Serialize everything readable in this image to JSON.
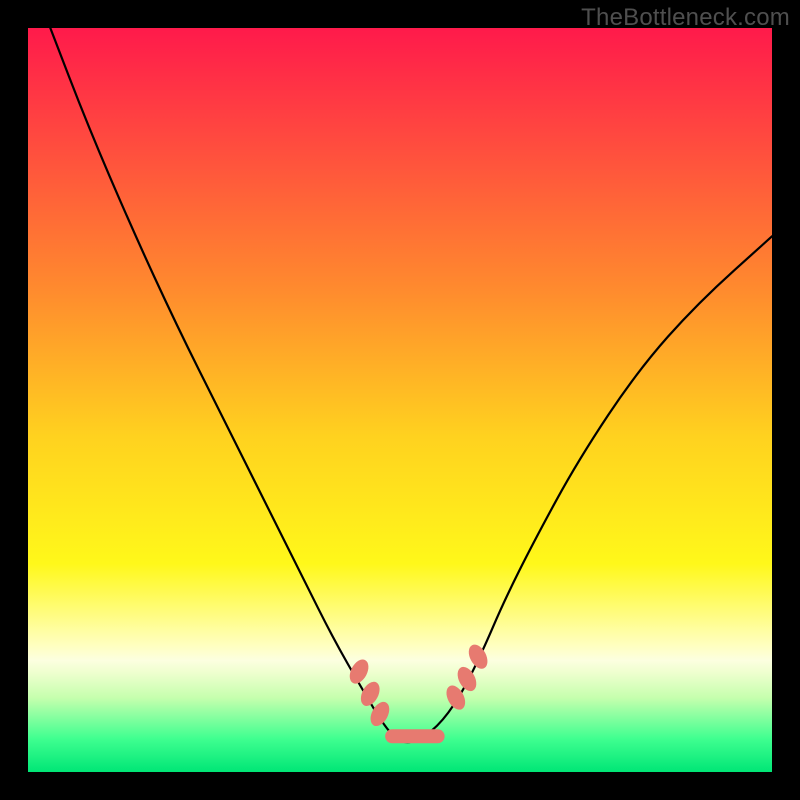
{
  "watermark": "TheBottleneck.com",
  "chart_data": {
    "type": "line",
    "title": "",
    "xlabel": "",
    "ylabel": "",
    "xlim": [
      0,
      100
    ],
    "ylim": [
      0,
      100
    ],
    "grid": false,
    "legend": false,
    "series": [
      {
        "name": "curve",
        "x": [
          3,
          8,
          14,
          20,
          26,
          32,
          37,
          41,
          45,
          48,
          50,
          52,
          55,
          58,
          61,
          64,
          68,
          74,
          82,
          90,
          100
        ],
        "y": [
          100,
          87,
          73,
          60,
          48,
          36,
          26,
          18,
          11,
          6,
          4,
          4,
          6,
          10,
          16,
          23,
          31,
          42,
          54,
          63,
          72
        ],
        "color": "#000000"
      }
    ],
    "markers": {
      "comment": "salmon rounded markers near the valley",
      "color": "#e77a70",
      "points_left": [
        [
          44.5,
          13.5
        ],
        [
          46.0,
          10.5
        ],
        [
          47.3,
          7.8
        ]
      ],
      "points_right": [
        [
          57.5,
          10.0
        ],
        [
          59.0,
          12.5
        ],
        [
          60.5,
          15.5
        ]
      ],
      "flat_bar": {
        "x0": 48.0,
        "x1": 56.0,
        "y": 4.8
      }
    },
    "gradient": {
      "comment": "vertical rainbow, red top → green bottom, with pale band ~y=12 and bright green floor",
      "stops": [
        {
          "pos": 0.0,
          "color": "#ff1a4b"
        },
        {
          "pos": 0.15,
          "color": "#ff4a3f"
        },
        {
          "pos": 0.35,
          "color": "#ff8a2e"
        },
        {
          "pos": 0.55,
          "color": "#ffd21f"
        },
        {
          "pos": 0.72,
          "color": "#fff81a"
        },
        {
          "pos": 0.83,
          "color": "#ffffc0"
        },
        {
          "pos": 0.85,
          "color": "#fcffe0"
        },
        {
          "pos": 0.865,
          "color": "#f0ffd0"
        },
        {
          "pos": 0.9,
          "color": "#c6ffae"
        },
        {
          "pos": 0.955,
          "color": "#40ff90"
        },
        {
          "pos": 1.0,
          "color": "#00e676"
        }
      ]
    }
  }
}
